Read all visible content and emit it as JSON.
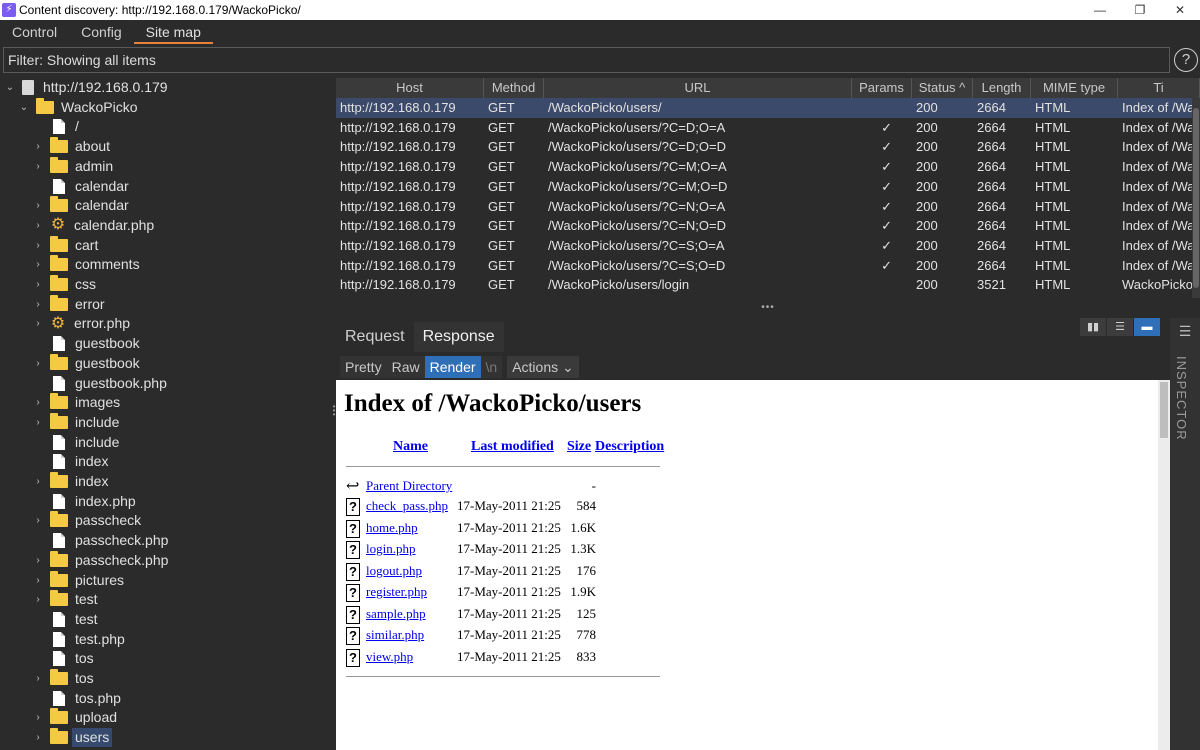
{
  "window": {
    "title": "Content discovery: http://192.168.0.179/WackoPicko/",
    "app_icon": "⚡"
  },
  "win_controls": {
    "minimize": "—",
    "restore": "❐",
    "close": "✕"
  },
  "top_tabs": [
    "Control",
    "Config",
    "Site map"
  ],
  "filter": {
    "text": "Filter: Showing all items"
  },
  "help": "?",
  "tree": [
    {
      "label": "http://192.168.0.179",
      "type": "host",
      "depth": 0,
      "expand": "open"
    },
    {
      "label": "WackoPicko",
      "type": "folder",
      "depth": 1,
      "expand": "open"
    },
    {
      "label": "/",
      "type": "file",
      "depth": 2,
      "expand": "none"
    },
    {
      "label": "about",
      "type": "folder",
      "depth": 2,
      "expand": "closed"
    },
    {
      "label": "admin",
      "type": "folder",
      "depth": 2,
      "expand": "closed"
    },
    {
      "label": "calendar",
      "type": "file",
      "depth": 2,
      "expand": "none"
    },
    {
      "label": "calendar",
      "type": "folder",
      "depth": 2,
      "expand": "closed"
    },
    {
      "label": "calendar.php",
      "type": "gear",
      "depth": 2,
      "expand": "closed"
    },
    {
      "label": "cart",
      "type": "folder",
      "depth": 2,
      "expand": "closed"
    },
    {
      "label": "comments",
      "type": "folder",
      "depth": 2,
      "expand": "closed"
    },
    {
      "label": "css",
      "type": "folder",
      "depth": 2,
      "expand": "closed"
    },
    {
      "label": "error",
      "type": "folder",
      "depth": 2,
      "expand": "closed"
    },
    {
      "label": "error.php",
      "type": "gear",
      "depth": 2,
      "expand": "closed"
    },
    {
      "label": "guestbook",
      "type": "file",
      "depth": 2,
      "expand": "none"
    },
    {
      "label": "guestbook",
      "type": "folder",
      "depth": 2,
      "expand": "closed"
    },
    {
      "label": "guestbook.php",
      "type": "file",
      "depth": 2,
      "expand": "none"
    },
    {
      "label": "images",
      "type": "folder",
      "depth": 2,
      "expand": "closed"
    },
    {
      "label": "include",
      "type": "folder",
      "depth": 2,
      "expand": "closed"
    },
    {
      "label": "include",
      "type": "file",
      "depth": 2,
      "expand": "none"
    },
    {
      "label": "index",
      "type": "file",
      "depth": 2,
      "expand": "none"
    },
    {
      "label": "index",
      "type": "folder",
      "depth": 2,
      "expand": "closed"
    },
    {
      "label": "index.php",
      "type": "file",
      "depth": 2,
      "expand": "none"
    },
    {
      "label": "passcheck",
      "type": "folder",
      "depth": 2,
      "expand": "closed"
    },
    {
      "label": "passcheck.php",
      "type": "file",
      "depth": 2,
      "expand": "none"
    },
    {
      "label": "passcheck.php",
      "type": "folder",
      "depth": 2,
      "expand": "closed"
    },
    {
      "label": "pictures",
      "type": "folder",
      "depth": 2,
      "expand": "closed"
    },
    {
      "label": "test",
      "type": "folder",
      "depth": 2,
      "expand": "closed"
    },
    {
      "label": "test",
      "type": "file",
      "depth": 2,
      "expand": "none"
    },
    {
      "label": "test.php",
      "type": "file",
      "depth": 2,
      "expand": "none"
    },
    {
      "label": "tos",
      "type": "file",
      "depth": 2,
      "expand": "none"
    },
    {
      "label": "tos",
      "type": "folder",
      "depth": 2,
      "expand": "closed"
    },
    {
      "label": "tos.php",
      "type": "file",
      "depth": 2,
      "expand": "none"
    },
    {
      "label": "upload",
      "type": "folder",
      "depth": 2,
      "expand": "closed"
    },
    {
      "label": "users",
      "type": "folder",
      "depth": 2,
      "expand": "closed",
      "selected": true
    }
  ],
  "table": {
    "columns": [
      "Host",
      "Method",
      "URL",
      "Params",
      "Status ^",
      "Length",
      "MIME type",
      "Ti"
    ],
    "rows": [
      {
        "host": "http://192.168.0.179",
        "method": "GET",
        "url": "/WackoPicko/users/",
        "params": "",
        "status": "200",
        "length": "2664",
        "mime": "HTML",
        "title": "Index of /Wa",
        "selected": true
      },
      {
        "host": "http://192.168.0.179",
        "method": "GET",
        "url": "/WackoPicko/users/?C=D;O=A",
        "params": "✓",
        "status": "200",
        "length": "2664",
        "mime": "HTML",
        "title": "Index of /Wa"
      },
      {
        "host": "http://192.168.0.179",
        "method": "GET",
        "url": "/WackoPicko/users/?C=D;O=D",
        "params": "✓",
        "status": "200",
        "length": "2664",
        "mime": "HTML",
        "title": "Index of /Wa"
      },
      {
        "host": "http://192.168.0.179",
        "method": "GET",
        "url": "/WackoPicko/users/?C=M;O=A",
        "params": "✓",
        "status": "200",
        "length": "2664",
        "mime": "HTML",
        "title": "Index of /Wa"
      },
      {
        "host": "http://192.168.0.179",
        "method": "GET",
        "url": "/WackoPicko/users/?C=M;O=D",
        "params": "✓",
        "status": "200",
        "length": "2664",
        "mime": "HTML",
        "title": "Index of /Wa"
      },
      {
        "host": "http://192.168.0.179",
        "method": "GET",
        "url": "/WackoPicko/users/?C=N;O=A",
        "params": "✓",
        "status": "200",
        "length": "2664",
        "mime": "HTML",
        "title": "Index of /Wa"
      },
      {
        "host": "http://192.168.0.179",
        "method": "GET",
        "url": "/WackoPicko/users/?C=N;O=D",
        "params": "✓",
        "status": "200",
        "length": "2664",
        "mime": "HTML",
        "title": "Index of /Wa"
      },
      {
        "host": "http://192.168.0.179",
        "method": "GET",
        "url": "/WackoPicko/users/?C=S;O=A",
        "params": "✓",
        "status": "200",
        "length": "2664",
        "mime": "HTML",
        "title": "Index of /Wa"
      },
      {
        "host": "http://192.168.0.179",
        "method": "GET",
        "url": "/WackoPicko/users/?C=S;O=D",
        "params": "✓",
        "status": "200",
        "length": "2664",
        "mime": "HTML",
        "title": "Index of /Wa"
      },
      {
        "host": "http://192.168.0.179",
        "method": "GET",
        "url": "/WackoPicko/users/login",
        "params": "",
        "status": "200",
        "length": "3521",
        "mime": "HTML",
        "title": "WackoPicko"
      }
    ]
  },
  "splitter_grip": "•••",
  "rr_tabs": [
    "Request",
    "Response"
  ],
  "layout_buttons": [
    "▮▮",
    "☰",
    "▬"
  ],
  "response_toolbar": {
    "pretty": "Pretty",
    "raw": "Raw",
    "render": "Render",
    "newline": "\\n",
    "actions": "Actions ⌄"
  },
  "rendered": {
    "title": "Index of /WackoPicko/users",
    "headers": {
      "name": "Name",
      "last_modified": "Last modified",
      "size": "Size",
      "description": "Description"
    },
    "parent": {
      "label": "Parent Directory",
      "size": "-"
    },
    "files": [
      {
        "name": "check_pass.php",
        "date": "17-May-2011 21:25",
        "size": "584"
      },
      {
        "name": "home.php",
        "date": "17-May-2011 21:25",
        "size": "1.6K"
      },
      {
        "name": "login.php",
        "date": "17-May-2011 21:25",
        "size": "1.3K"
      },
      {
        "name": "logout.php",
        "date": "17-May-2011 21:25",
        "size": "176"
      },
      {
        "name": "register.php",
        "date": "17-May-2011 21:25",
        "size": "1.9K"
      },
      {
        "name": "sample.php",
        "date": "17-May-2011 21:25",
        "size": "125"
      },
      {
        "name": "similar.php",
        "date": "17-May-2011 21:25",
        "size": "778"
      },
      {
        "name": "view.php",
        "date": "17-May-2011 21:25",
        "size": "833"
      }
    ]
  },
  "inspector": {
    "label": "INSPECTOR",
    "icon": "☰"
  },
  "colors": {
    "background": "#2b2b2b",
    "accent_tab": "#e8823a",
    "selection": "#3b4a6b",
    "button_active": "#2f6fb7",
    "folder": "#f6c945"
  }
}
